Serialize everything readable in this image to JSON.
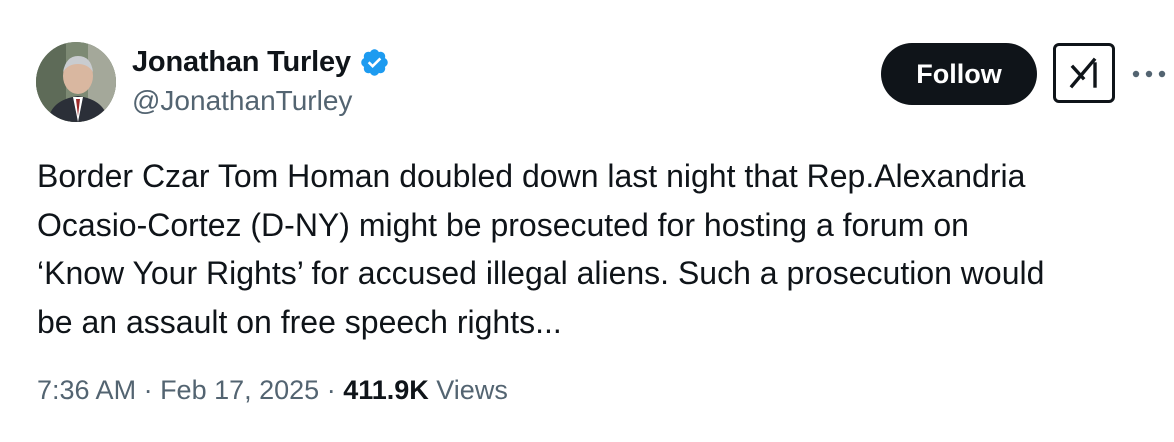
{
  "tweet": {
    "author": {
      "display_name": "Jonathan Turley",
      "handle": "@JonathanTurley",
      "verified": true,
      "avatar_icon": "user-avatar-photo"
    },
    "actions": {
      "follow_label": "Follow",
      "grok_icon": "grok-icon",
      "more_icon": "more-horizontal-icon"
    },
    "text": "Border Czar Tom Homan doubled down last night that Rep.Alexandria\nOcasio-Cortez (D-NY) might be prosecuted for hosting a forum on\n‘Know Your Rights’ for accused illegal aliens. Such a prosecution would\nbe an assault on free speech rights...",
    "meta": {
      "time": "7:36 AM",
      "separator": " · ",
      "date": "Feb 17, 2025",
      "views_count": "411.9K",
      "views_label": " Views"
    }
  },
  "colors": {
    "text_primary": "#0f1419",
    "text_secondary": "#536471",
    "verified_blue": "#1d9bf0",
    "follow_bg": "#0f1419"
  }
}
